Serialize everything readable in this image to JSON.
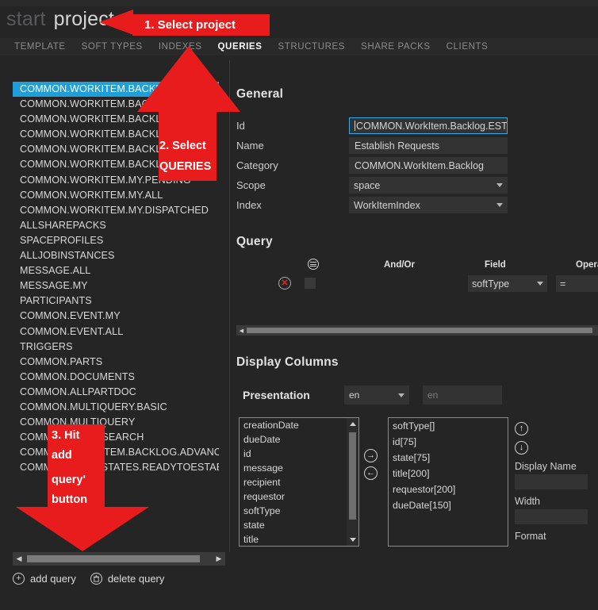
{
  "header": {
    "brand_start": "start",
    "brand_project": "project"
  },
  "nav": {
    "tabs": [
      {
        "label": "TEMPLATE",
        "active": false
      },
      {
        "label": "SOFT TYPES",
        "active": false
      },
      {
        "label": "INDEXES",
        "active": false
      },
      {
        "label": "QUERIES",
        "active": true
      },
      {
        "label": "STRUCTURES",
        "active": false
      },
      {
        "label": "SHARE PACKS",
        "active": false
      },
      {
        "label": "CLIENTS",
        "active": false
      }
    ]
  },
  "query_list": {
    "items": [
      {
        "label": "COMMON.WORKITEM.BACKLOG.ESTREQ",
        "selected": true
      },
      {
        "label": "COMMON.WORKITEM.BACKLOG.READY",
        "selected": false
      },
      {
        "label": "COMMON.WORKITEM.BACKLOG.WIP",
        "selected": false
      },
      {
        "label": "COMMON.WORKITEM.BACKLOG.DONE",
        "selected": false
      },
      {
        "label": "COMMON.WORKITEM.BACKLOG.ACTIVE",
        "selected": false
      },
      {
        "label": "COMMON.WORKITEM.BACKLOG.ALL",
        "selected": false
      },
      {
        "label": "COMMON.WORKITEM.MY.PENDING",
        "selected": false
      },
      {
        "label": "COMMON.WORKITEM.MY.ALL",
        "selected": false
      },
      {
        "label": "COMMON.WORKITEM.MY.DISPATCHED",
        "selected": false
      },
      {
        "label": "ALLSHAREPACKS",
        "selected": false
      },
      {
        "label": "SPACEPROFILES",
        "selected": false
      },
      {
        "label": "ALLJOBINSTANCES",
        "selected": false
      },
      {
        "label": "MESSAGE.ALL",
        "selected": false
      },
      {
        "label": "MESSAGE.MY",
        "selected": false
      },
      {
        "label": "PARTICIPANTS",
        "selected": false
      },
      {
        "label": "COMMON.EVENT.MY",
        "selected": false
      },
      {
        "label": "COMMON.EVENT.ALL",
        "selected": false
      },
      {
        "label": "TRIGGERS",
        "selected": false
      },
      {
        "label": "COMMON.PARTS",
        "selected": false
      },
      {
        "label": "COMMON.DOCUMENTS",
        "selected": false
      },
      {
        "label": "COMMON.ALLPARTDOC",
        "selected": false
      },
      {
        "label": "COMMON.MULTIQUERY.BASIC",
        "selected": false
      },
      {
        "label": "COMMON.MULTIQUERY",
        "selected": false
      },
      {
        "label": "COMMON.QUICKSEARCH",
        "selected": false
      },
      {
        "label": "COMMON.WORKITEM.BACKLOG.ADVANCED",
        "selected": false
      },
      {
        "label": "COMMON.LEVELSTATES.READYTOESTABLISH",
        "selected": false
      }
    ],
    "hscroll_left_arrow": "◀",
    "hscroll_right_arrow": "▶"
  },
  "actions": {
    "add_query": "add query",
    "add_icon": "+",
    "delete_query": "delete query",
    "delete_icon": "🗑"
  },
  "general": {
    "title": "General",
    "rows": [
      {
        "label": "Id",
        "value": "COMMON.WorkItem.Backlog.ESTRE",
        "type": "text",
        "focused": true
      },
      {
        "label": "Name",
        "value": "Establish Requests",
        "type": "text",
        "focused": false
      },
      {
        "label": "Category",
        "value": "COMMON.WorkItem.Backlog",
        "type": "text",
        "focused": false
      },
      {
        "label": "Scope",
        "value": "space",
        "type": "select",
        "focused": false
      },
      {
        "label": "Index",
        "value": "WorkItemIndex",
        "type": "select",
        "focused": false
      }
    ]
  },
  "query": {
    "title": "Query",
    "headers": {
      "menu": "row-menu",
      "andor": "And/Or",
      "field": "Field",
      "operator": "Opera"
    },
    "row": {
      "delete_icon": "✕",
      "field_value": "softType",
      "operator_value": "="
    },
    "hscroll_left_arrow": "◀"
  },
  "display_columns": {
    "title": "Display Columns",
    "presentation_label": "Presentation",
    "locale_selected": "en",
    "locale_placeholder": "en",
    "available": [
      "creationDate",
      "dueDate",
      "id",
      "message",
      "recipient",
      "requestor",
      "softType",
      "state",
      "title"
    ],
    "selected": [
      "softType[]",
      "id[75]",
      "state[75]",
      "title[200]",
      "requestor[200]",
      "dueDate[150]"
    ],
    "add_icon": "→",
    "remove_icon": "←",
    "move_up_icon": "↑",
    "move_down_icon": "↓",
    "display_name_label": "Display Name",
    "display_name_value": "",
    "width_label": "Width",
    "width_value": "",
    "format_label": "Format"
  },
  "annotations": [
    {
      "id": "1",
      "text": "1. Select project"
    },
    {
      "id": "2",
      "line1": "2. Select",
      "line2": "QUERIES"
    },
    {
      "id": "3",
      "line1": "3. Hit",
      "line2": "add",
      "line3": "query'",
      "line4": "button"
    }
  ],
  "colors": {
    "background": "#252526",
    "selection": "#1f9ed8",
    "annotation": "#e81c1c",
    "focus_border": "#3ba7e5",
    "field_bg": "#333334"
  }
}
